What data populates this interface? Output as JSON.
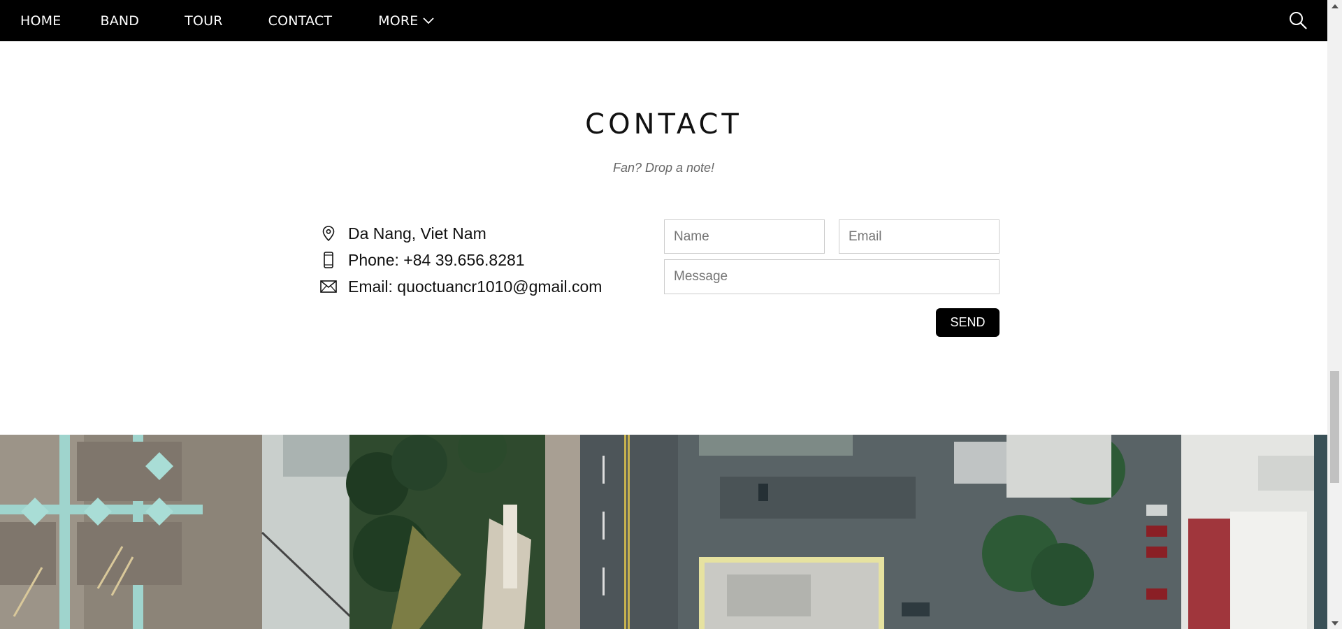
{
  "nav": {
    "items": [
      {
        "label": "HOME"
      },
      {
        "label": "BAND"
      },
      {
        "label": "TOUR"
      },
      {
        "label": "CONTACT"
      },
      {
        "label": "MORE"
      }
    ],
    "search_icon": "search-icon",
    "more_icon": "chevron-down-icon"
  },
  "contact": {
    "title": "CONTACT",
    "subtitle": "Fan? Drop a note!",
    "info": [
      {
        "icon": "location-pin-icon",
        "text": "Da Nang, Viet Nam"
      },
      {
        "icon": "mobile-phone-icon",
        "text": "Phone: +84 39.656.8281"
      },
      {
        "icon": "envelope-icon",
        "text": "Email: quoctuancr1010@gmail.com"
      }
    ],
    "form": {
      "name_placeholder": "Name",
      "email_placeholder": "Email",
      "message_placeholder": "Message",
      "send_label": "SEND"
    }
  },
  "colors": {
    "nav_bg": "#000000",
    "nav_text": "#ffffff",
    "button_bg": "#000000",
    "page_bg": "#ffffff"
  }
}
